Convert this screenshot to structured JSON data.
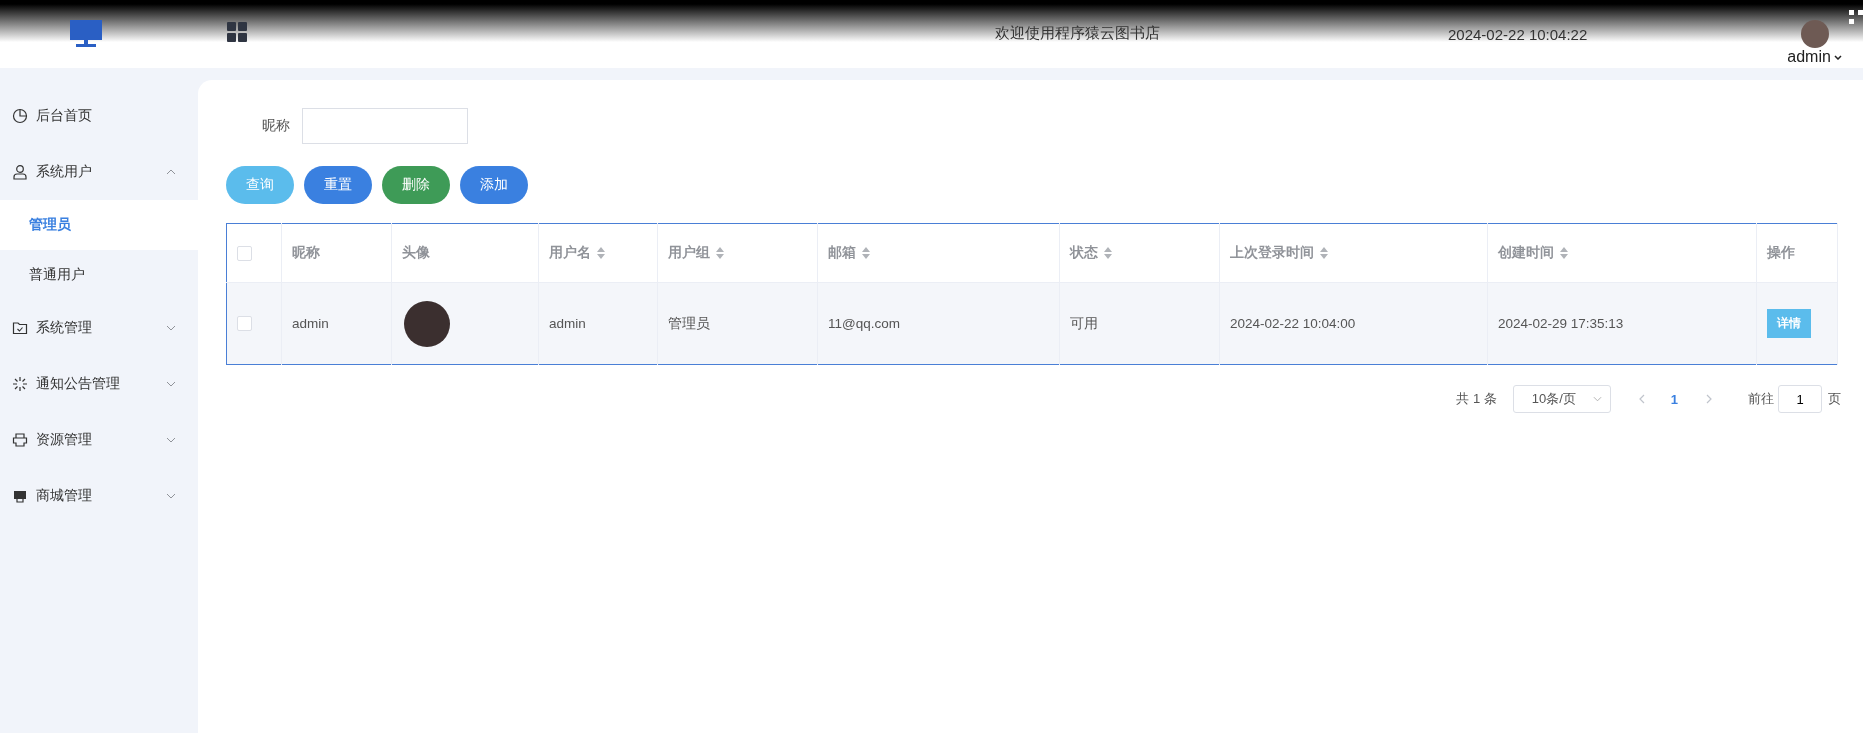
{
  "header": {
    "title": "欢迎使用程序猿云图书店",
    "datetime": "2024-02-22 10:04:22",
    "user": "admin"
  },
  "sidebar": {
    "items": [
      {
        "label": "后台首页",
        "selected": false
      },
      {
        "label": "系统用户",
        "selected": false,
        "expanded": true,
        "children": [
          {
            "label": "管理员",
            "selected": true
          },
          {
            "label": "普通用户",
            "selected": false
          }
        ]
      },
      {
        "label": "系统管理",
        "selected": false,
        "expanded": false
      },
      {
        "label": "通知公告管理",
        "selected": false,
        "expanded": false
      },
      {
        "label": "资源管理",
        "selected": false,
        "expanded": false
      },
      {
        "label": "商城管理",
        "selected": false,
        "expanded": false
      }
    ]
  },
  "search": {
    "label": "昵称"
  },
  "buttons": [
    {
      "label": "查询",
      "color": "#5bbcec"
    },
    {
      "label": "重置",
      "color": "#3a80e0"
    },
    {
      "label": "删除",
      "color": "#3e9b57"
    },
    {
      "label": "添加",
      "color": "#3a80e0"
    }
  ],
  "table": {
    "header_checked": false,
    "columns": [
      {
        "label": "昵称",
        "sortable": false
      },
      {
        "label": "头像",
        "sortable": false
      },
      {
        "label": "用户名",
        "sortable": true
      },
      {
        "label": "用户组",
        "sortable": true
      },
      {
        "label": "邮箱",
        "sortable": true
      },
      {
        "label": "状态",
        "sortable": true
      },
      {
        "label": "上次登录时间",
        "sortable": true
      },
      {
        "label": "创建时间",
        "sortable": true
      },
      {
        "label": "操作",
        "sortable": false
      }
    ],
    "rows": [
      {
        "checked": false,
        "nickname": "admin",
        "username": "admin",
        "group": "管理员",
        "email": "11@qq.com",
        "status": "可用",
        "last_login": "2024-02-22 10:04:00",
        "created": "2024-02-29 17:35:13",
        "action": "详情"
      }
    ]
  },
  "pagination": {
    "total": "共 1 条",
    "page_size": "10条/页",
    "pages": [
      {
        "label": "1",
        "selected": true
      }
    ],
    "goto_label": "前往",
    "goto_value": "1",
    "goto_suffix": "页"
  }
}
